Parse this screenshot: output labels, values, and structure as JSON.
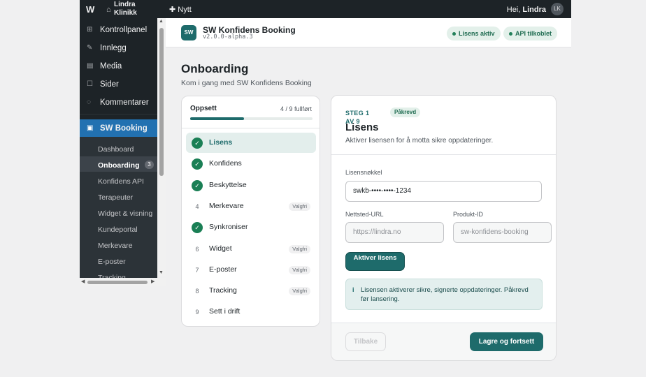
{
  "adminbar": {
    "wp_logo": "W",
    "site_name": "Lindra Klinikk",
    "new_label": "Nytt",
    "greeting_prefix": "Hei,",
    "user": "Lindra",
    "avatar_initials": "LK"
  },
  "sidebar": {
    "items": [
      {
        "label": "Kontrollpanel",
        "icon": "dashboard-icon"
      },
      {
        "label": "Innlegg",
        "icon": "pin-icon"
      },
      {
        "label": "Media",
        "icon": "media-icon"
      },
      {
        "label": "Sider",
        "icon": "page-icon"
      },
      {
        "label": "Kommentarer",
        "icon": "comment-icon"
      },
      {
        "label": "SW Booking",
        "icon": "booking-icon"
      }
    ],
    "submenu": [
      {
        "label": "Dashboard"
      },
      {
        "label": "Onboarding",
        "badge": "3"
      },
      {
        "label": "Konfidens API"
      },
      {
        "label": "Terapeuter"
      },
      {
        "label": "Widget & visning"
      },
      {
        "label": "Kundeportal"
      },
      {
        "label": "Merkevare"
      },
      {
        "label": "E-poster"
      },
      {
        "label": "Tracking"
      }
    ]
  },
  "plugin": {
    "logo": "SW",
    "name": "SW Konfidens Booking",
    "version": "v2.0.0-alpha.3",
    "status_license": "Lisens aktiv",
    "status_api": "API tilkoblet"
  },
  "page": {
    "title": "Onboarding",
    "subtitle": "Kom i gang med SW Konfidens Booking"
  },
  "setup": {
    "heading": "Oppsett",
    "count": "4 / 9 fullført",
    "progress": 0.44,
    "steps": [
      {
        "num": "1",
        "label": "Lisens",
        "done": true,
        "active": true
      },
      {
        "num": "2",
        "label": "Konfidens",
        "done": true
      },
      {
        "num": "3",
        "label": "Beskyttelse",
        "done": true
      },
      {
        "num": "4",
        "label": "Merkevare",
        "done": false,
        "optional": "Valgfri"
      },
      {
        "num": "5",
        "label": "Synkroniser",
        "done": true
      },
      {
        "num": "6",
        "label": "Widget",
        "done": false,
        "optional": "Valgfri"
      },
      {
        "num": "7",
        "label": "E-poster",
        "done": false,
        "optional": "Valgfri"
      },
      {
        "num": "8",
        "label": "Tracking",
        "done": false,
        "optional": "Valgfri"
      },
      {
        "num": "9",
        "label": "Sett i drift",
        "done": false
      }
    ]
  },
  "form": {
    "step_label": "STEG 1 AV 9",
    "required_badge": "Påkrevd",
    "title": "Lisens",
    "description": "Aktiver lisensen for å motta sikre oppdateringer.",
    "license_key_label": "Lisensnøkkel",
    "license_key_value": "swkb-••••-••••-1234",
    "site_url_label": "Nettsted-URL",
    "site_url_placeholder": "https://lindra.no",
    "product_id_label": "Produkt-ID",
    "product_id_placeholder": "sw-konfidens-booking",
    "activate_label": "Aktiver lisens",
    "notice": "Lisensen aktiverer sikre, signerte oppdateringer. Påkrevd før lansering.",
    "back_label": "Tilbake",
    "save_label": "Lagre og fortsett"
  }
}
